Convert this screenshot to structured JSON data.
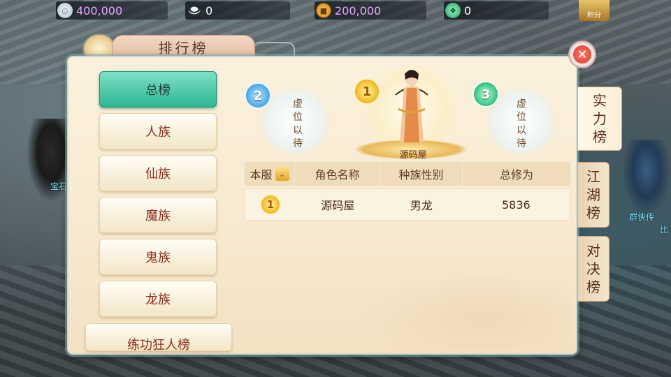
{
  "currencies": [
    {
      "icon": "silver-coin-icon",
      "value": "400,000"
    },
    {
      "icon": "silver-ingot-icon",
      "value": "0"
    },
    {
      "icon": "copper-coin-icon",
      "value": "200,000"
    },
    {
      "icon": "jade-icon",
      "value": "0"
    }
  ],
  "points_label": "积分",
  "panel": {
    "title": "排行榜",
    "close_symbol": "✕"
  },
  "categories": [
    "总榜",
    "人族",
    "仙族",
    "魔族",
    "鬼族",
    "龙族",
    "练功狂人榜"
  ],
  "active_category": "总榜",
  "podium": {
    "first": {
      "rank": "1",
      "name": "源码屋"
    },
    "second": {
      "rank": "2",
      "vacant_text": [
        "虚",
        "位",
        "以",
        "待"
      ]
    },
    "third": {
      "rank": "3",
      "vacant_text": [
        "虚",
        "位",
        "以",
        "待"
      ]
    }
  },
  "table": {
    "server_filter": "本服",
    "headers": [
      "角色名称",
      "种族性别",
      "总修为"
    ],
    "rows": [
      {
        "rank": "1",
        "name": "源码屋",
        "race_gender": "男龙",
        "score": "5836"
      }
    ]
  },
  "side_tabs": [
    "实力榜",
    "江湖榜",
    "对决榜"
  ],
  "active_side_tab": "实力榜",
  "background_labels": [
    "宝石",
    "群侠传",
    "比"
  ],
  "colors": {
    "accent_teal": "#2fb595",
    "currency_purple": "#e9a6ff",
    "panel_bg": "#f7e9cf",
    "close_red": "#d63a2a"
  }
}
